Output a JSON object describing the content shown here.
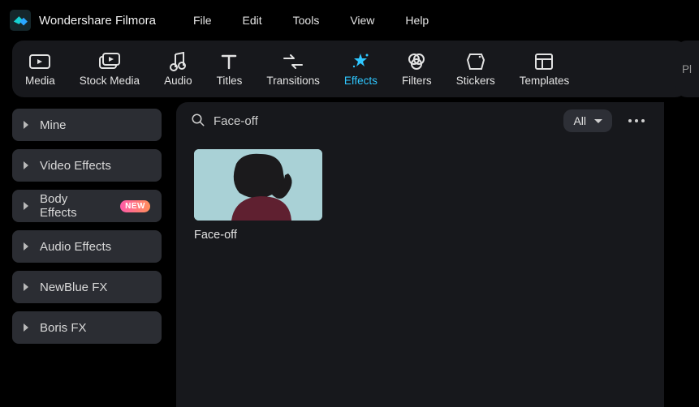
{
  "app": {
    "title": "Wondershare Filmora"
  },
  "menus": [
    "File",
    "Edit",
    "Tools",
    "View",
    "Help"
  ],
  "ribbon": {
    "tabs": [
      {
        "label": "Media"
      },
      {
        "label": "Stock Media"
      },
      {
        "label": "Audio"
      },
      {
        "label": "Titles"
      },
      {
        "label": "Transitions"
      },
      {
        "label": "Effects",
        "active": true
      },
      {
        "label": "Filters"
      },
      {
        "label": "Stickers"
      },
      {
        "label": "Templates"
      }
    ]
  },
  "right_panel_hint": "Pl",
  "sidebar": {
    "items": [
      {
        "label": "Mine"
      },
      {
        "label": "Video Effects"
      },
      {
        "label": "Body Effects",
        "new_badge": "NEW"
      },
      {
        "label": "Audio Effects"
      },
      {
        "label": "NewBlue FX"
      },
      {
        "label": "Boris FX"
      }
    ]
  },
  "toolbar": {
    "search_value": "Face-off",
    "filter_label": "All"
  },
  "results": [
    {
      "label": "Face-off"
    }
  ],
  "colors": {
    "accent": "#2fc7ff"
  }
}
